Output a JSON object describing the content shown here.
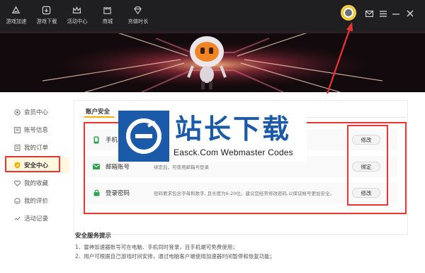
{
  "nav": {
    "items": [
      {
        "label": "游戏加速",
        "icon": "speed-logo-icon"
      },
      {
        "label": "游戏下载",
        "icon": "download-icon"
      },
      {
        "label": "活动中心",
        "icon": "crown-icon"
      },
      {
        "label": "商城",
        "icon": "castle-icon"
      },
      {
        "label": "充值时长",
        "icon": "diamond-icon"
      }
    ],
    "window_buttons": [
      "mail-icon",
      "menu-icon",
      "minimize-icon",
      "close-icon"
    ]
  },
  "sidebar": {
    "items": [
      {
        "label": "会员中心",
        "icon": "member-icon"
      },
      {
        "label": "账号信息",
        "icon": "account-info-icon"
      },
      {
        "label": "我的订单",
        "icon": "order-icon"
      },
      {
        "label": "安全中心",
        "icon": "shield-icon",
        "active": true
      },
      {
        "label": "我的收藏",
        "icon": "heart-icon"
      },
      {
        "label": "我的评价",
        "icon": "comment-icon"
      },
      {
        "label": "活动记录",
        "icon": "activity-icon"
      }
    ]
  },
  "main": {
    "tab": "账户安全",
    "rows": [
      {
        "name": "手机",
        "desc": "",
        "button": "修改",
        "icon": "phone-icon"
      },
      {
        "name": "邮箱账号",
        "desc": "绑定后，可使用邮箱号登录",
        "button": "绑定",
        "icon": "mail-icon"
      },
      {
        "name": "登录密码",
        "desc": "密码要求包含字母和数字, 且长度为6-20位。建议您经常修改密码,以保证帐号更加安全。",
        "button": "修改",
        "icon": "lock-icon"
      }
    ]
  },
  "tips": {
    "title": "安全服务提示",
    "lines": [
      "1、雷神加速器账号可在电脑、手机同时登录，且手机端可免费使用；",
      "2、用户可根据自己游戏时间安排，通过电脑客户端使用加速器时间暂停和恢复功能；"
    ]
  },
  "watermark": {
    "cn": "站长下载",
    "en": "Easck.Com Webmaster Codes"
  },
  "colors": {
    "accent": "#f0b400",
    "annotation": "#e33333",
    "topbar": "#1f1f22",
    "watermark_blue": "#1a5aa8"
  }
}
